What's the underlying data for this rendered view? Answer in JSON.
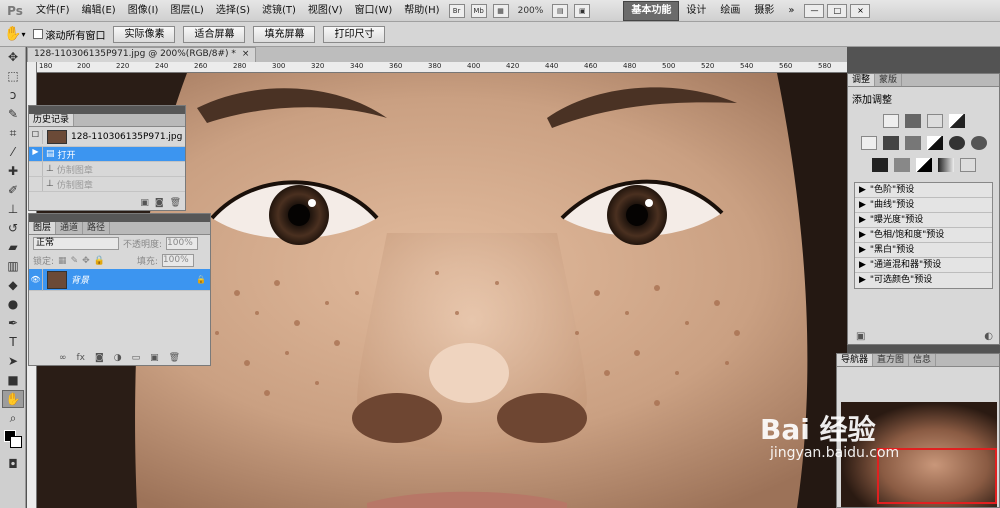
{
  "app": {
    "logo": "Ps"
  },
  "menu": [
    "文件(F)",
    "编辑(E)",
    "图像(I)",
    "图层(L)",
    "选择(S)",
    "滤镜(T)",
    "视图(V)",
    "窗口(W)",
    "帮助(H)"
  ],
  "topbar": {
    "br_label": "Br",
    "mb_label": "Mb",
    "zoom": "200%",
    "workspaces": [
      "基本功能",
      "设计",
      "绘画",
      "摄影"
    ],
    "win_controls": [
      "—",
      "□",
      "×"
    ]
  },
  "options": {
    "scroll_all": "滚动所有窗口",
    "buttons": [
      "实际像素",
      "适合屏幕",
      "填充屏幕",
      "打印尺寸"
    ]
  },
  "document": {
    "tab_title": "128-110306135P971.jpg @ 200%(RGB/8#) *",
    "close": "×",
    "ruler_ticks": [
      "180",
      "200",
      "220",
      "240",
      "260",
      "280",
      "300",
      "320",
      "340",
      "360",
      "380",
      "400",
      "420",
      "440",
      "460",
      "480",
      "500",
      "520",
      "540",
      "560",
      "580"
    ]
  },
  "history": {
    "title": "历史记录",
    "snapshot": "128-110306135P971.jpg",
    "items": [
      {
        "label": "打开",
        "state": "selected"
      },
      {
        "label": "仿制图章",
        "state": "dim"
      },
      {
        "label": "仿制图章",
        "state": "dim"
      }
    ]
  },
  "layers": {
    "tabs": [
      "图层",
      "通道",
      "路径"
    ],
    "blend_mode": "正常",
    "opacity_label": "不透明度:",
    "opacity": "100%",
    "lock_label": "锁定:",
    "fill_label": "填充:",
    "fill": "100%",
    "layer_name": "背景"
  },
  "adjustments": {
    "tabs": [
      "调整",
      "蒙版"
    ],
    "title": "添加调整",
    "presets": [
      "\"色阶\"预设",
      "\"曲线\"预设",
      "\"曝光度\"预设",
      "\"色相/饱和度\"预设",
      "\"黑白\"预设",
      "\"通道混和器\"预设",
      "\"可选颜色\"预设"
    ]
  },
  "navigator": {
    "tabs": [
      "导航器",
      "直方图",
      "信息"
    ]
  },
  "watermark": {
    "brand": "Bai 经验",
    "url": "jingyan.baidu.com"
  },
  "colors": {
    "selection_blue": "#3c95f0",
    "panel_bg": "#d8d8d8",
    "nav_rect": "#e02020"
  }
}
